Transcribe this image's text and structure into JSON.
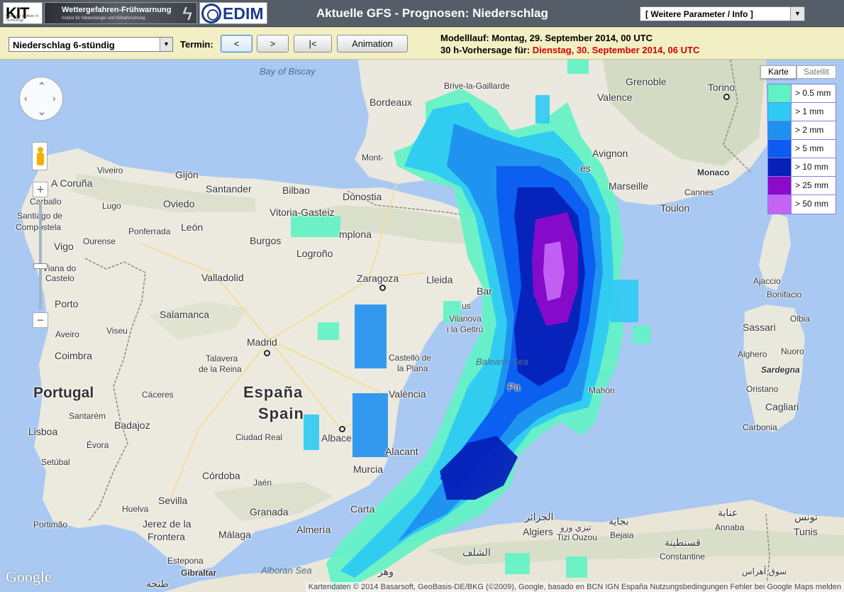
{
  "header": {
    "logo_kit": "KIT",
    "logo_kit_sub": "Karlsruhe Institute of Technology",
    "logo_warn_title": "Wettergefahren-Frühwarnung",
    "logo_warn_sub": "Institut für Meteorologie und Klimaforschung",
    "logo_cedim": "EDIM",
    "title": "Aktuelle GFS - Prognosen: Niederschlag",
    "param_select": "[ Weitere Parameter / Info ]"
  },
  "controls": {
    "product_select": "Niederschlag 6-stündig",
    "termin_label": "Termin:",
    "prev_label": "<",
    "next_label": ">",
    "first_label": "|<",
    "animation_label": "Animation",
    "model_run": "Modelllauf: Montag, 29. September 2014, 00 UTC",
    "forecast_prefix": "30 h-Vorhersage für: ",
    "forecast_time": "Dienstag, 30. September 2014, 06 UTC"
  },
  "map": {
    "maptype_map": "Karte",
    "maptype_sat": "Satellit",
    "zoom_in": "+",
    "zoom_out": "−",
    "attribution": "Kartendaten © 2014 Basarsoft, GeoBasis-DE/BKG (©2009), Google, basado en BCN IGN España   Nutzungsbedingungen   Fehler bei Google Maps melden",
    "google": "Google",
    "labels": {
      "bay_of_biscay": "Bay of Biscay",
      "balearic_sea": "Balearic Sea",
      "alboran_sea": "Alboran Sea",
      "espana": "España",
      "spain": "Spain",
      "portugal": "Portugal",
      "bordeaux": "Bordeaux",
      "brive": "Brive-la-Gaillarde",
      "grenoble": "Grenoble",
      "torino": "Torino",
      "valence": "Valence",
      "mont": "Mont-",
      "avignon": "Avignon",
      "es": "es",
      "marseille": "Marseille",
      "monaco": "Monaco",
      "cannes": "Cannes",
      "toulon": "Toulon",
      "viveiro": "Viveiro",
      "gijon": "Gijón",
      "santander": "Santander",
      "bilbao": "Bilbao",
      "donostia": "Donostia",
      "a_coruna": "A Coruña",
      "carballo": "Carballo",
      "lugo": "Lugo",
      "oviedo": "Oviedo",
      "vitoria": "Vitoria-Gasteiz",
      "santiago": "Santiago de",
      "compostela": "Compostela",
      "ponferrada": "Ponferrada",
      "leon": "León",
      "pamplona": "mplona",
      "vigo": "Vigo",
      "ourense": "Ourense",
      "burgos": "Burgos",
      "logrono": "Logroño",
      "viana": "Viana do",
      "castelo": "Castelo",
      "valladolid": "Valladolid",
      "zaragoza": "Zaragoza",
      "lleida": "Lleida",
      "bar": "Bar",
      "porto": "Porto",
      "salamanca": "Salamanca",
      "us": "us",
      "vilanova": "Vilanova",
      "geltru": "i la Geltrú",
      "aveiro": "Aveiro",
      "viseu": "Viseu",
      "coimbra": "Coimbra",
      "madrid": "Madrid",
      "talavera": "Talavera",
      "de_la_reina": "de la Reina",
      "castello": "Castelló de",
      "la_plana": "la Plana",
      "caceres": "Cáceres",
      "valencia": "València",
      "santarem": "Santarém",
      "badajoz": "Badajoz",
      "ciudad_real": "Ciudad Real",
      "albacete": "Albace",
      "lisboa": "Lisboa",
      "evora": "Évora",
      "alicant": "Alacant",
      "setubal": "Setúbal",
      "cordoba": "Córdoba",
      "murcia": "Murcia",
      "jaen": "Jaén",
      "huelva": "Huelva",
      "sevilla": "Sevilla",
      "granada": "Granada",
      "carta": "Carta",
      "portimao": "Portimão",
      "jerez": "Jerez de la",
      "frontera": "Frontera",
      "malaga": "Málaga",
      "almeria": "Almería",
      "estepona": "Estepona",
      "gibraltar": "Gibraltar",
      "pa": "Pa",
      "mahon": "Mahón",
      "ajaccio": "Ajaccio",
      "bonifacio": "Bonifacio",
      "sassari": "Sassari",
      "olbia": "Olbia",
      "alghero": "Alghero",
      "nuoro": "Nuoro",
      "sardegna": "Sardegna",
      "oristano": "Oristano",
      "cagliari": "Cagliari",
      "carbonia": "Carbonia",
      "algiers_ar": "الجزائر",
      "algiers": "Algiers",
      "tizi_ar": "تيزي وزو",
      "tizi": "Tizi Ouzou",
      "bejaia_ar": "بجاية",
      "bejaia": "Bejaia",
      "annaba_ar": "عنابة",
      "annaba": "Annaba",
      "tunis_ar": "تونس",
      "tunis": "Tunis",
      "constantine_ar": "قسنطينة",
      "constantine": "Constantine",
      "chlef_ar": "الشلف",
      "wahran_ar": "وهر",
      "tangier_ar": "طنجة",
      "souk_ar": "سوق أهراس"
    }
  },
  "legend": [
    {
      "label": "> 0.5 mm",
      "color": "#5ff3c4"
    },
    {
      "label": "> 1 mm",
      "color": "#2ecaf3"
    },
    {
      "label": "> 2 mm",
      "color": "#1e90ef"
    },
    {
      "label": "> 5 mm",
      "color": "#0b5cf0"
    },
    {
      "label": "> 10 mm",
      "color": "#0620b8"
    },
    {
      "label": "> 25 mm",
      "color": "#8c0ac9"
    },
    {
      "label": "> 50 mm",
      "color": "#c464f4"
    }
  ]
}
